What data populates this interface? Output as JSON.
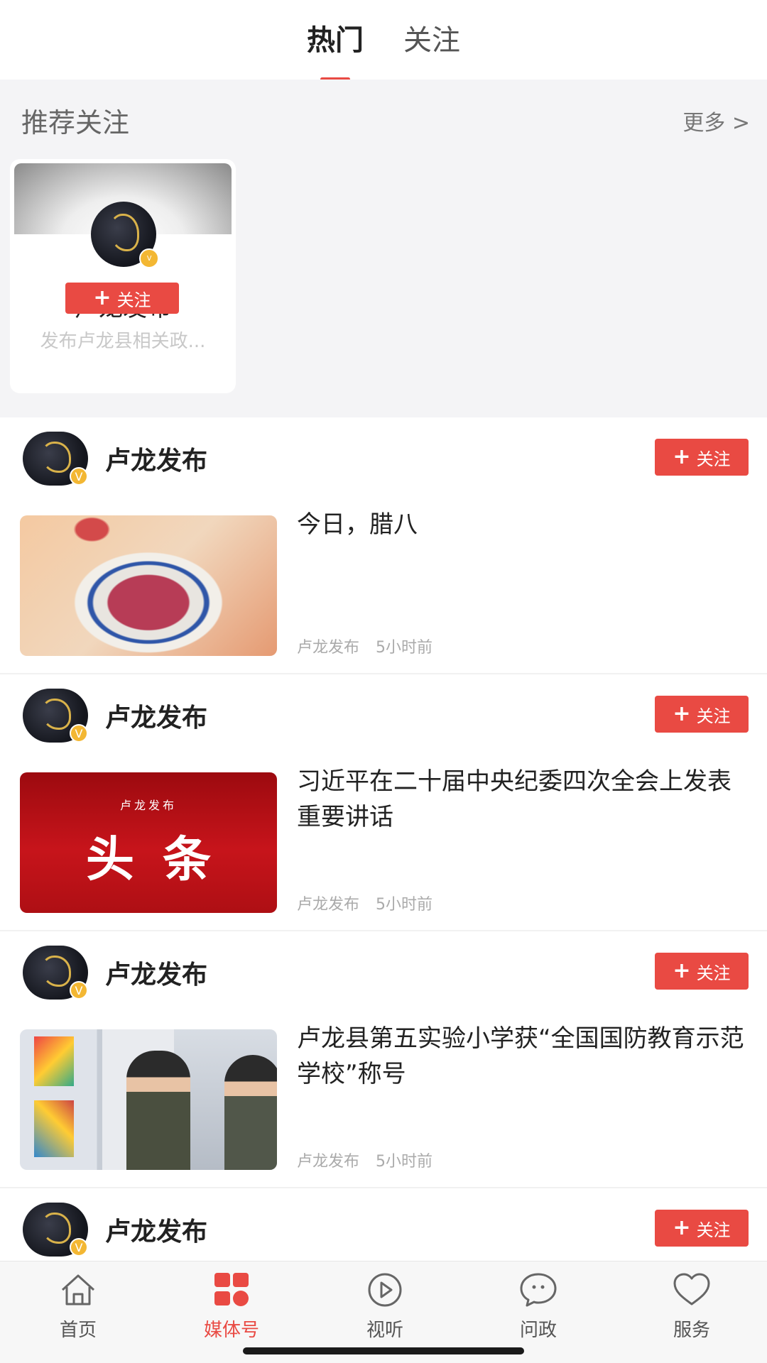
{
  "tabs": [
    {
      "label": "热门",
      "active": true
    },
    {
      "label": "关注",
      "active": false
    }
  ],
  "recommend": {
    "title": "推荐关注",
    "more": "更多 >",
    "card": {
      "name": "卢龙发布",
      "desc": "发布卢龙县相关政...",
      "follow": "关注"
    }
  },
  "posts": [
    {
      "author": "卢龙发布",
      "follow": "关注",
      "title": "今日，腊八",
      "source": "卢龙发布",
      "time": "5小时前",
      "thumb": "porridge"
    },
    {
      "author": "卢龙发布",
      "follow": "关注",
      "title": "习近平在二十届中央纪委四次全会上发表重要讲话",
      "source": "卢龙发布",
      "time": "5小时前",
      "thumb": "headline",
      "thumb_small": "卢龙发布",
      "thumb_big": "头条"
    },
    {
      "author": "卢龙发布",
      "follow": "关注",
      "title": "卢龙县第五实验小学获“全国国防教育示范学校”称号",
      "source": "卢龙发布",
      "time": "5小时前",
      "thumb": "school"
    },
    {
      "author": "卢龙发布",
      "follow": "关注"
    }
  ],
  "nav": [
    {
      "label": "首页",
      "icon": "home-icon",
      "active": false
    },
    {
      "label": "媒体号",
      "icon": "grid-icon",
      "active": true
    },
    {
      "label": "视听",
      "icon": "play-icon",
      "active": false
    },
    {
      "label": "问政",
      "icon": "chat-icon",
      "active": false
    },
    {
      "label": "服务",
      "icon": "heart-icon",
      "active": false
    }
  ],
  "colors": {
    "accent": "#e94a43",
    "badge": "#f3b733"
  }
}
